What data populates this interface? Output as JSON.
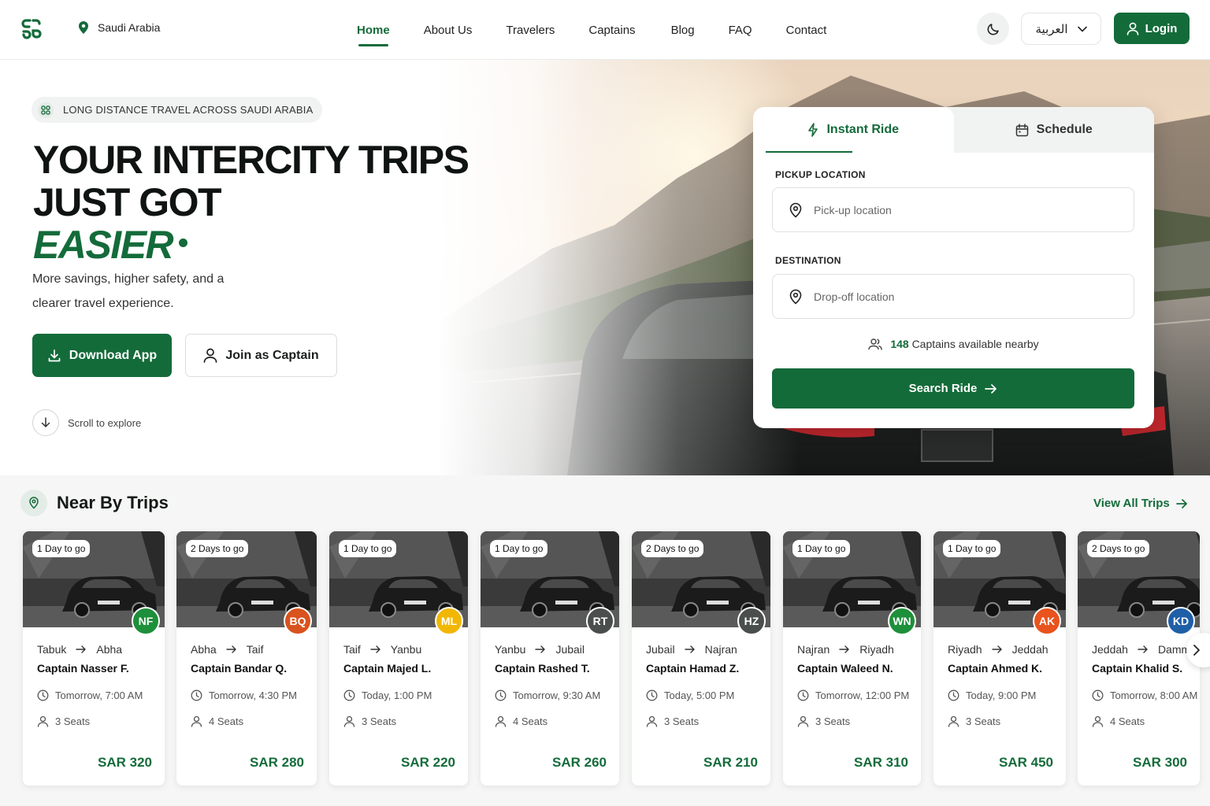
{
  "nav": {
    "location": "Saudi Arabia",
    "links": [
      "Home",
      "About Us",
      "Travelers",
      "Captains",
      "Blog",
      "FAQ",
      "Contact"
    ],
    "active": "Home",
    "language": "العربية",
    "login": "Login",
    "accent": "#146b3a"
  },
  "hero": {
    "badge": "LONG DISTANCE TRAVEL ACROSS SAUDI ARABIA",
    "title_line1": "YOUR INTERCITY TRIPS",
    "title_line2": "JUST GOT",
    "title_line3": "EASIER",
    "subtitle": "More savings, higher safety, and a clearer travel experience.",
    "download_btn": "Download App",
    "captain_btn": "Join as Captain",
    "scroll_hint": "Scroll to explore"
  },
  "booking": {
    "tab_instant": "Instant Ride",
    "tab_schedule": "Schedule",
    "pickup_label": "PICKUP LOCATION",
    "pickup_placeholder": "Pick-up location",
    "dest_label": "DESTINATION",
    "dest_placeholder": "Drop-off location",
    "captains_count": "148",
    "captains_text": "Captains available nearby",
    "search_btn": "Search Ride"
  },
  "trips": {
    "title": "Near By Trips",
    "view_all": "View All Trips",
    "items": [
      {
        "days": "1 Day to go",
        "initials": "NF",
        "color": "#1e8f3a",
        "from": "Tabuk",
        "to": "Abha",
        "captain": "Captain Nasser F.",
        "time": "Tomorrow, 7:00 AM",
        "seats": "3 Seats",
        "price": "SAR 320"
      },
      {
        "days": "2 Days to go",
        "initials": "BQ",
        "color": "#d9531e",
        "from": "Abha",
        "to": "Taif",
        "captain": "Captain Bandar Q.",
        "time": "Tomorrow, 4:30 PM",
        "seats": "4 Seats",
        "price": "SAR 280"
      },
      {
        "days": "1 Day to go",
        "initials": "ML",
        "color": "#f2b705",
        "from": "Taif",
        "to": "Yanbu",
        "captain": "Captain Majed L.",
        "time": "Today, 1:00 PM",
        "seats": "3 Seats",
        "price": "SAR 220"
      },
      {
        "days": "1 Day to go",
        "initials": "RT",
        "color": "#4a4f4d",
        "from": "Yanbu",
        "to": "Jubail",
        "captain": "Captain Rashed T.",
        "time": "Tomorrow, 9:30 AM",
        "seats": "4 Seats",
        "price": "SAR 260"
      },
      {
        "days": "2 Days to go",
        "initials": "HZ",
        "color": "#4a4f4d",
        "from": "Jubail",
        "to": "Najran",
        "captain": "Captain Hamad Z.",
        "time": "Today, 5:00 PM",
        "seats": "3 Seats",
        "price": "SAR 210"
      },
      {
        "days": "1 Day to go",
        "initials": "WN",
        "color": "#1e8f3a",
        "from": "Najran",
        "to": "Riyadh",
        "captain": "Captain Waleed N.",
        "time": "Tomorrow, 12:00 PM",
        "seats": "3 Seats",
        "price": "SAR 310"
      },
      {
        "days": "1 Day to go",
        "initials": "AK",
        "color": "#e8531e",
        "from": "Riyadh",
        "to": "Jeddah",
        "captain": "Captain Ahmed K.",
        "time": "Today, 9:00 PM",
        "seats": "3 Seats",
        "price": "SAR 450"
      },
      {
        "days": "2 Days to go",
        "initials": "KD",
        "color": "#1f5fa8",
        "from": "Jeddah",
        "to": "Damm",
        "captain": "Captain Khalid S.",
        "time": "Tomorrow, 8:00 AM",
        "seats": "4 Seats",
        "price": "SAR 300"
      }
    ]
  }
}
